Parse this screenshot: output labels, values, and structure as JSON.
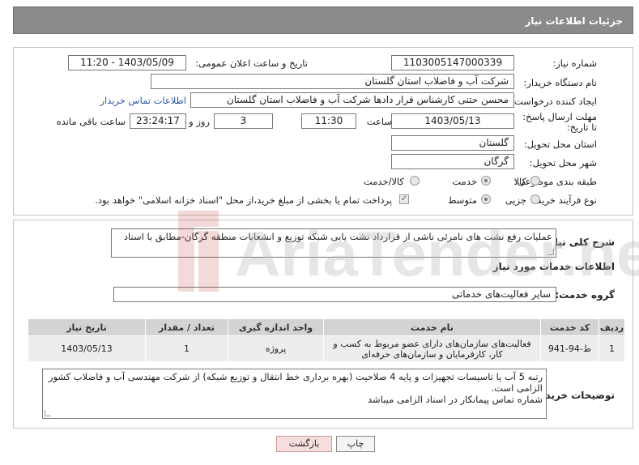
{
  "header": {
    "title": "جزئیات اطلاعات نیاز"
  },
  "form": {
    "need_number_label": "شماره نیاز:",
    "need_number": "1103005147000339",
    "announce_label": "تاریخ و ساعت اعلان عمومی:",
    "announce_value": "1403/05/09 - 11:20",
    "buyer_org_label": "نام دستگاه خریدار:",
    "buyer_org": "شرکت آب و فاضلاب استان گلستان",
    "creator_label": "ایجاد کننده درخواست:",
    "creator": "محسن حتنی کارشناس قرار دادها شرکت آب و فاضلاب استان گلستان",
    "contact_link": "اطلاعات تماس خریدار",
    "deadline_label": "مهلت ارسال پاسخ: تا تاریخ:",
    "deadline_date": "1403/05/13",
    "time_label": "ساعت",
    "deadline_time": "11:30",
    "days_value": "3",
    "days_label": "روز و",
    "remaining_time": "23:24:17",
    "remaining_label": "ساعت باقی مانده",
    "province_label": "استان محل تحویل:",
    "province": "گلستان",
    "city_label": "شهر محل تحویل:",
    "city": "گرگان",
    "category_label": "طبقه بندی موضوعی:",
    "category_options": [
      "کالا",
      "خدمت",
      "کالا/خدمت"
    ],
    "process_label": "نوع فرآیند خرید :",
    "process_options": [
      "جزیی",
      "متوسط"
    ],
    "payment_note": "پرداخت تمام یا بخشی از مبلغ خرید،از محل \"اسناد خزانه اسلامی\" خواهد بود."
  },
  "summary": {
    "label": "شرح کلی نیاز:",
    "text": "عملیات رفع نشت های نامرئی ناشی از قرارداد نشت یابی شبکه توزیع و انشعابات منطقه گرگان-مطابق با اسناد"
  },
  "services": {
    "section_title": "اطلاعات خدمات مورد نیاز",
    "group_label": "گروه خدمت:",
    "group_value": "سایر فعالیت‌های خدماتی",
    "columns": [
      "ردیف",
      "کد خدمت",
      "نام خدمت",
      "واحد اندازه گیری",
      "تعداد / مقدار",
      "تاریخ نیاز"
    ],
    "rows": [
      [
        "1",
        "ط-94-941",
        "فعالیت‌های سازمان‌های دارای عضو مربوط به کسب و کار، کارفرمایان و سازمان‌های حرفه‌ای",
        "پروژه",
        "1",
        "1403/05/13"
      ]
    ]
  },
  "buyer_notes": {
    "label": "توضیحات خریدار:",
    "lines": [
      "رتبه 5 آب یا تاسیسات تجهیزات و پایه 4 صلاحیت (بهره برداری خط انتقال و توزیع شبکه) از شرکت مهندسی آب و فاضلاب کشور الزامی است.",
      "شماره تماس پیمانکار در اسناد الزامی میباشد"
    ]
  },
  "buttons": {
    "print": "چاپ",
    "back": "بازگشت"
  },
  "watermark": "AriaTender.neT"
}
